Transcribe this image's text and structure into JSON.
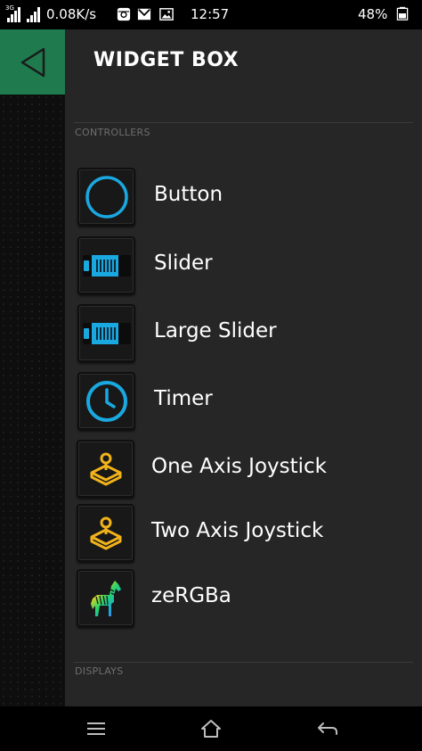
{
  "status_bar": {
    "network_type": "3G",
    "speed": "0.08K/s",
    "time": "12:57",
    "battery": "48%",
    "icons": [
      "signal-icon",
      "signal-icon",
      "instagram-icon",
      "gmail-icon",
      "image-icon",
      "battery-icon"
    ]
  },
  "back_button": {
    "icon": "back-triangle-icon"
  },
  "drawer": {
    "title": "WIDGET BOX",
    "sections": [
      {
        "label": "CONTROLLERS",
        "items": [
          {
            "label": "Button",
            "icon": "button-ring-icon"
          },
          {
            "label": "Slider",
            "icon": "slider-icon"
          },
          {
            "label": "Large Slider",
            "icon": "large-slider-icon"
          },
          {
            "label": "Timer",
            "icon": "clock-icon"
          },
          {
            "label": "One Axis Joystick",
            "icon": "joystick-icon"
          },
          {
            "label": "Two Axis Joystick",
            "icon": "joystick-icon"
          },
          {
            "label": "zeRGBa",
            "icon": "zebra-icon"
          }
        ]
      },
      {
        "label": "DISPLAYS",
        "items": []
      }
    ]
  },
  "nav_bar": {
    "icons": [
      "menu-icon",
      "home-icon",
      "back-arrow-icon"
    ]
  },
  "colors": {
    "accent_cyan": "#1aa8e0",
    "accent_yellow": "#f2b31a",
    "back_tile_green": "#1f7a4e",
    "drawer_bg": "#262626"
  }
}
